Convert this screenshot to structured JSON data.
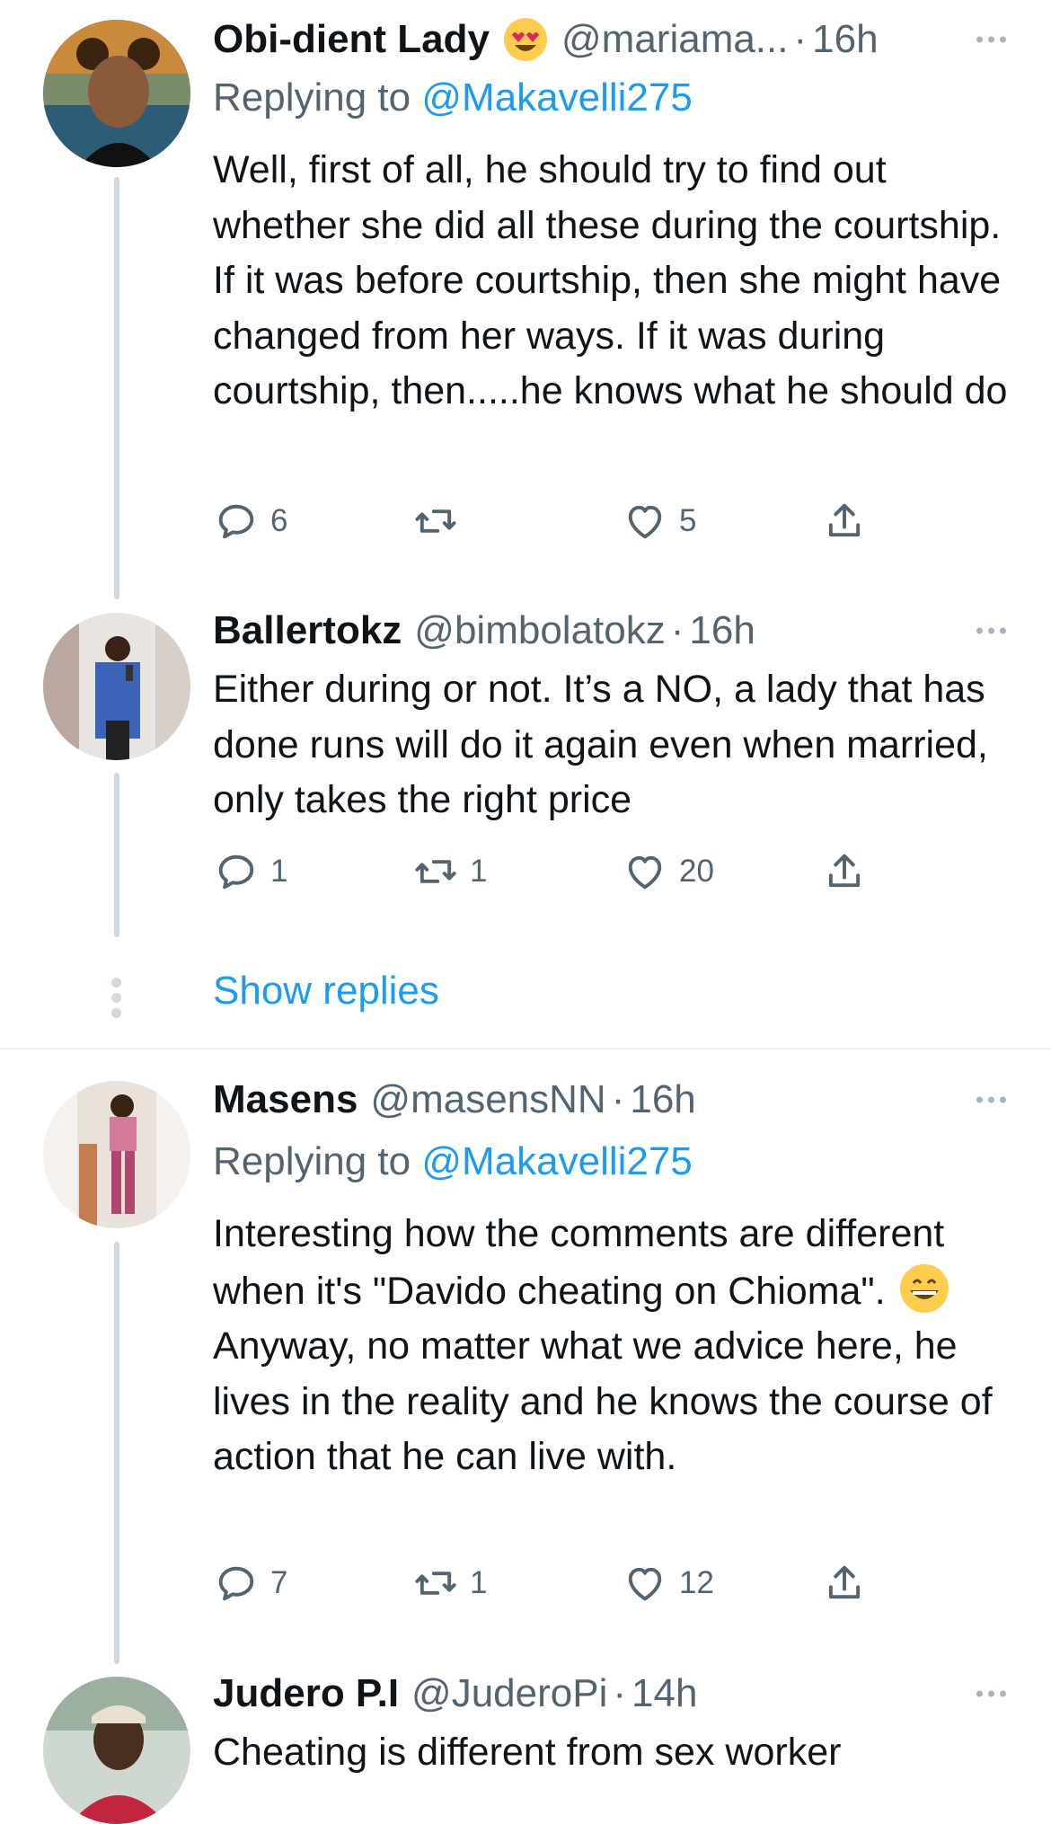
{
  "tweets": [
    {
      "name": "Obi-dient Lady",
      "name_emoji": "heart-eyes-emoji",
      "handle": "@mariama...",
      "dot": "·",
      "time": "16h",
      "replying_prefix": "Replying to",
      "replying_to": "@Makavelli275",
      "text": "Well, first of all, he should try to find out whether she did all these during the courtship. If it was before courtship, then she might have changed from her ways. If it was during courtship, then.....he knows what he should do",
      "replies": "6",
      "retweets": "",
      "likes": "5"
    },
    {
      "name": "Ballertokz",
      "handle": "@bimbolatokz",
      "dot": "·",
      "time": "16h",
      "text": "Either during or not. It’s a NO, a lady that has done runs will do it again even when married, only takes the right price",
      "replies": "1",
      "retweets": "1",
      "likes": "20"
    },
    {
      "name": "Masens",
      "handle": "@masensNN",
      "dot": "·",
      "time": "16h",
      "replying_prefix": "Replying to",
      "replying_to": "@Makavelli275",
      "text_part1": "Interesting how the comments are different when it's \"Davido cheating on Chioma\".",
      "text_emoji": "grinning-emoji",
      "text_part2": "Anyway, no matter what we advice here, he lives in the reality and he knows the course of action that he can live with.",
      "replies": "7",
      "retweets": "1",
      "likes": "12"
    },
    {
      "name": "Judero P.I",
      "handle": "@JuderoPi",
      "dot": "·",
      "time": "14h",
      "text": "Cheating is different from sex worker"
    }
  ],
  "show_replies": "Show replies",
  "colors": {
    "link": "#1d9bf0",
    "secondary": "#536471",
    "thread_line": "#cfd9de",
    "text": "#0f1419"
  },
  "icons": [
    "reply-icon",
    "retweet-icon",
    "like-icon",
    "share-icon",
    "more-icon"
  ]
}
